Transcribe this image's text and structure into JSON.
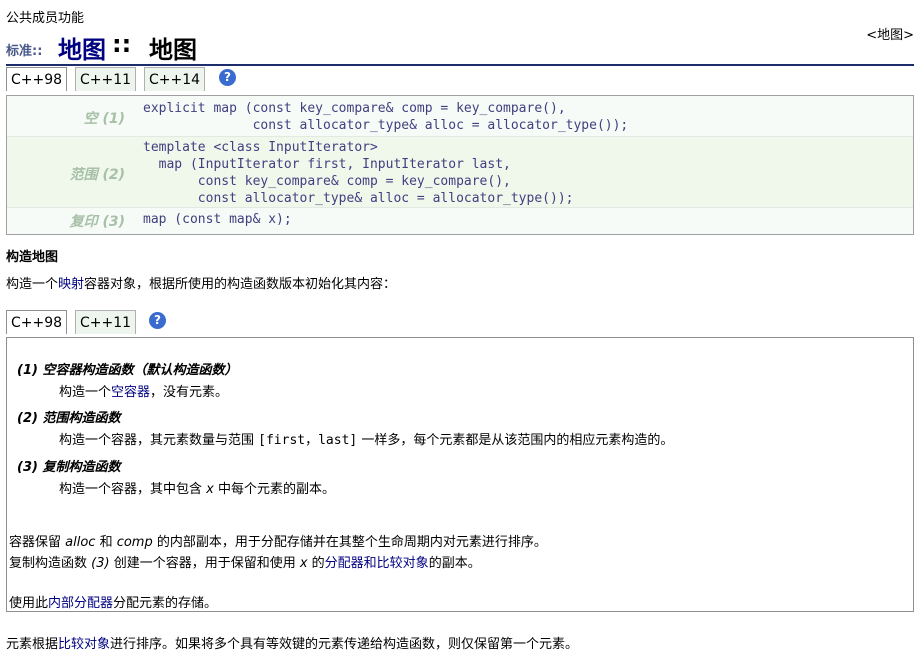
{
  "category": "公共成员功能",
  "header": {
    "standard_label": "标准::",
    "namespace": "地图",
    "separator": "::",
    "function_name": "地图",
    "hint": "<地图>"
  },
  "tabs_top": [
    {
      "label": "C++98"
    },
    {
      "label": "C++11"
    },
    {
      "label": "C++14"
    }
  ],
  "tabs_mid": [
    {
      "label": "C++98"
    },
    {
      "label": "C++11"
    }
  ],
  "help_glyph": "?",
  "prototypes": [
    {
      "label": "空 (1)",
      "code": "explicit map (const key_compare& comp = key_compare(),\n              const allocator_type& alloc = allocator_type());"
    },
    {
      "label": "范围 (2)",
      "code": "template <class InputIterator>\n  map (InputIterator first, InputIterator last,\n       const key_compare& comp = key_compare(),\n       const allocator_type& alloc = allocator_type());"
    },
    {
      "label": "复印 (3)",
      "code": "map (const map& x);"
    }
  ],
  "section_title": "构造地图",
  "intro": {
    "pre": "构造一个",
    "link": "映射",
    "post": "容器对象，根据所使用的构造函数版本初始化其内容："
  },
  "constructors": [
    {
      "title": "(1) 空容器构造函数（默认构造函数）",
      "desc_pre": "构造一个",
      "desc_link": "空容器",
      "desc_post": "，没有元素。"
    },
    {
      "title": "(2) 范围构造函数",
      "desc_pre": "构造一个容器，其元素数量与范围 ",
      "desc_code": "[first，last]",
      "desc_post": " 一样多，每个元素都是从该范围内的相应元素构造的。"
    },
    {
      "title": "(3) 复制构造函数",
      "desc_pre": "构造一个容器，其中包含 ",
      "desc_var": "x",
      "desc_post": " 中每个元素的副本。"
    }
  ],
  "para1": {
    "t1": "容器保留 ",
    "v1": "alloc",
    "t2": " 和 ",
    "v2": "comp",
    "t3": " 的内部副本，用于分配存储并在其整个生命周期内对元素进行排序。"
  },
  "para2": {
    "t1": "复制构造函数 ",
    "v1": "(3)",
    "t2": " 创建一个容器，用于保留和使用 ",
    "v2": "x",
    "t3": " 的",
    "link": "分配器和比较对象",
    "t4": "的副本。"
  },
  "para3": {
    "t1": "使用此",
    "link": "内部分配器",
    "t2": "分配元素的存储。"
  },
  "footer": {
    "t1": "元素根据",
    "link": "比较对象",
    "t2": "进行排序。如果将多个具有等效键的元素传递给构造函数，则仅保留第一个元素。"
  },
  "colors": {
    "link": "#000080",
    "header_rule": "#1c2d6b",
    "proto_bg": "#f7fbf7",
    "label": "#a8c0a8",
    "help": "#3a6cd0"
  }
}
